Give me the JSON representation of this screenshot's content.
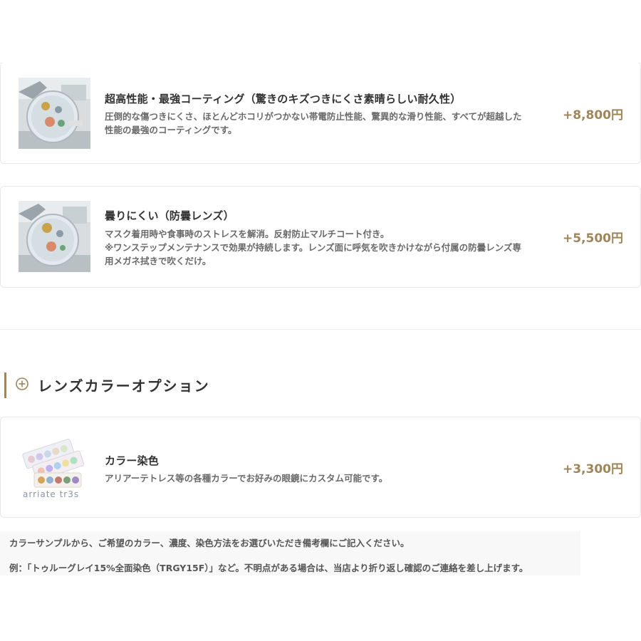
{
  "options": [
    {
      "title": "超高性能・最強コーティング（驚きのキズつきにくさ素晴らしい耐久性）",
      "desc_lines": [
        "圧倒的な傷つきにくさ、ほとんどホコリがつかない帯電防止性能、驚異的な滑り性能、すべてが超越した",
        "性能の最強のコーティングです。"
      ],
      "price": "+8,800円"
    },
    {
      "title": "曇りにくい（防曇レンズ）",
      "desc_lines": [
        "マスク着用時や食事時のストレスを解消。反射防止マルチコート付き。",
        "※ワンステップメンテナンスで効果が持続します。レンズ面に呼気を吹きかけながら付属の防曇レンズ専",
        "用メガネ拭きで吹くだけ。"
      ],
      "price": "+5,500円"
    }
  ],
  "color_section": {
    "title": "レンズカラーオプション",
    "icon": "plus-circle-icon",
    "item": {
      "title": "カラー染色",
      "desc": "アリアーテトレス等の各種カラーでお好みの眼鏡にカスタム可能です。",
      "price": "+3,300円",
      "brand": "arriate tr3s"
    }
  },
  "note": {
    "line1": "カラーサンプルから、ご希望のカラー、濃度、染色方法をお選びいただき備考欄にご記入ください。",
    "line2": "例：「トゥルーグレイ15%全面染色（TRGY15F）」など。不明点がある場合は、当店より折り返し確認のご連絡を差し上げます。"
  },
  "colors": {
    "accent": "#a0855b",
    "border": "#e8e8e8",
    "note_bg": "#f8f8f8"
  }
}
